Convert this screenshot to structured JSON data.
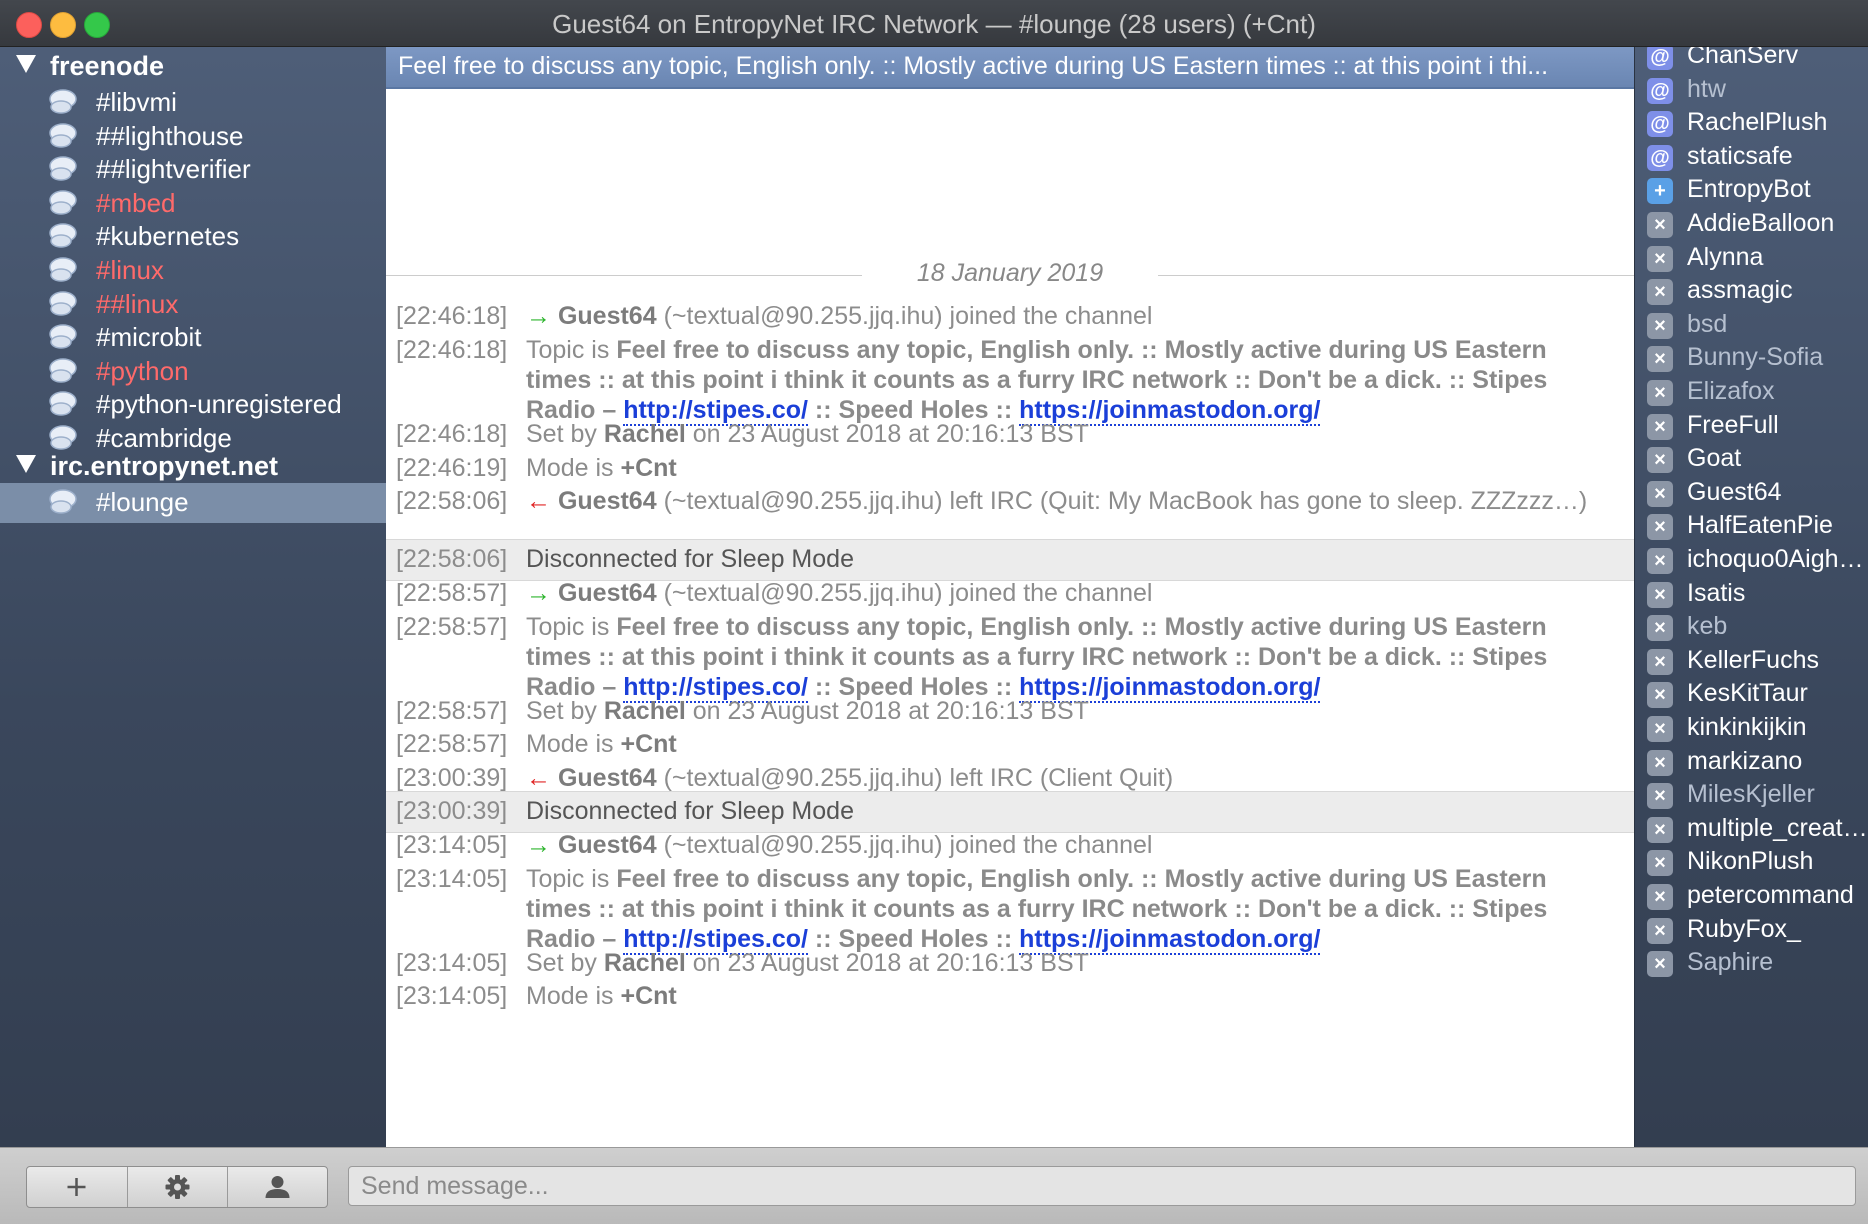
{
  "window": {
    "title": "Guest64 on EntropyNet IRC Network — #lounge (28 users) (+Cnt)"
  },
  "servers": [
    {
      "name": "freenode",
      "channels": [
        {
          "name": "#libvmi",
          "active": true
        },
        {
          "name": "##lighthouse",
          "active": true
        },
        {
          "name": "##lightverifier",
          "active": true
        },
        {
          "name": "#mbed",
          "active": false
        },
        {
          "name": "#kubernetes",
          "active": true
        },
        {
          "name": "#linux",
          "active": false
        },
        {
          "name": "##linux",
          "active": false
        },
        {
          "name": "#microbit",
          "active": true
        },
        {
          "name": "#python",
          "active": false
        },
        {
          "name": "#python-unregistered",
          "active": true
        },
        {
          "name": "#cambridge",
          "active": true
        }
      ]
    },
    {
      "name": "irc.entropynet.net",
      "channels": [
        {
          "name": "#lounge",
          "active": true,
          "selected": true
        }
      ]
    }
  ],
  "topic_bar": "Feel free to discuss any topic, English only. :: Mostly active during US Eastern times :: at this point i thi...",
  "date_divider": "18 January 2019",
  "topic_text": "Feel free to discuss any topic, English only. :: Mostly active during US Eastern times :: at this point i think it counts as a furry IRC network :: Don't be a dick. :: Stipes Radio – ",
  "topic_link1": "http://stipes.co/",
  "topic_mid": " :: Speed Holes :: ",
  "topic_link2": "https://joinmastodon.org/",
  "messages": {
    "m1": {
      "ts": "[22:46:18]",
      "nick": "Guest64",
      "rest": " (~textual@90.255.jjq.ihu) joined the channel"
    },
    "m2": {
      "ts": "[22:46:18]",
      "label": "Topic is "
    },
    "m3": {
      "ts": "[22:46:18]",
      "pre": "Set by ",
      "nick": "Rachel",
      "rest": " on 23 August 2018 at 20:16:13 BST"
    },
    "m4": {
      "ts": "[22:46:19]",
      "pre": "Mode is ",
      "mode": "+Cnt"
    },
    "m5": {
      "ts": "[22:58:06]",
      "nick": "Guest64",
      "rest": " (~textual@90.255.jjq.ihu) left IRC (Quit: My MacBook has gone to sleep. ZZZzzz…)"
    },
    "d1": {
      "ts": "[22:58:06]",
      "text": "Disconnected for Sleep Mode"
    },
    "m6": {
      "ts": "[22:58:57]",
      "nick": "Guest64",
      "rest": " (~textual@90.255.jjq.ihu) joined the channel"
    },
    "m7": {
      "ts": "[22:58:57]",
      "label": "Topic is "
    },
    "m8": {
      "ts": "[22:58:57]",
      "pre": "Set by ",
      "nick": "Rachel",
      "rest": " on 23 August 2018 at 20:16:13 BST"
    },
    "m9": {
      "ts": "[22:58:57]",
      "pre": "Mode is ",
      "mode": "+Cnt"
    },
    "m10": {
      "ts": "[23:00:39]",
      "nick": "Guest64",
      "rest": " (~textual@90.255.jjq.ihu) left IRC (Client Quit)"
    },
    "d2": {
      "ts": "[23:00:39]",
      "text": "Disconnected for Sleep Mode"
    },
    "m11": {
      "ts": "[23:14:05]",
      "nick": "Guest64",
      "rest": " (~textual@90.255.jjq.ihu) joined the channel"
    },
    "m12": {
      "ts": "[23:14:05]",
      "label": "Topic is "
    },
    "m13": {
      "ts": "[23:14:05]",
      "pre": "Set by ",
      "nick": "Rachel",
      "rest": " on 23 August 2018 at 20:16:13 BST"
    },
    "m14": {
      "ts": "[23:14:05]",
      "pre": "Mode is ",
      "mode": "+Cnt"
    }
  },
  "users": [
    {
      "name": "ChanServ",
      "mode": "op",
      "away": false
    },
    {
      "name": "htw",
      "mode": "op",
      "away": true
    },
    {
      "name": "RachelPlush",
      "mode": "op",
      "away": false
    },
    {
      "name": "staticsafe",
      "mode": "op",
      "away": false
    },
    {
      "name": "EntropyBot",
      "mode": "voice",
      "away": false
    },
    {
      "name": "AddieBalloon",
      "mode": "none",
      "away": false
    },
    {
      "name": "Alynna",
      "mode": "none",
      "away": false
    },
    {
      "name": "assmagic",
      "mode": "none",
      "away": false
    },
    {
      "name": "bsd",
      "mode": "none",
      "away": true
    },
    {
      "name": "Bunny-Sofia",
      "mode": "none",
      "away": true
    },
    {
      "name": "Elizafox",
      "mode": "none",
      "away": true
    },
    {
      "name": "FreeFull",
      "mode": "none",
      "away": false
    },
    {
      "name": "Goat",
      "mode": "none",
      "away": false
    },
    {
      "name": "Guest64",
      "mode": "none",
      "away": false
    },
    {
      "name": "HalfEatenPie",
      "mode": "none",
      "away": false
    },
    {
      "name": "ichoquo0Aigh…",
      "mode": "none",
      "away": false
    },
    {
      "name": "Isatis",
      "mode": "none",
      "away": false
    },
    {
      "name": "keb",
      "mode": "none",
      "away": true
    },
    {
      "name": "KellerFuchs",
      "mode": "none",
      "away": false
    },
    {
      "name": "KesKitTaur",
      "mode": "none",
      "away": false
    },
    {
      "name": "kinkinkijkin",
      "mode": "none",
      "away": false
    },
    {
      "name": "markizano",
      "mode": "none",
      "away": false
    },
    {
      "name": "MilesKjeller",
      "mode": "none",
      "away": true
    },
    {
      "name": "multiple_creat…",
      "mode": "none",
      "away": false
    },
    {
      "name": "NikonPlush",
      "mode": "none",
      "away": false
    },
    {
      "name": "petercommand",
      "mode": "none",
      "away": false
    },
    {
      "name": "RubyFox_",
      "mode": "none",
      "away": false
    },
    {
      "name": "Saphire",
      "mode": "none",
      "away": true
    }
  ],
  "badges": {
    "op": "@",
    "voice": "+",
    "none": "×"
  },
  "input": {
    "placeholder": "Send message..."
  },
  "toolbar": {
    "add_icon": "plus-icon",
    "settings_icon": "gear-icon",
    "user_icon": "person-icon"
  },
  "colors": {
    "inactive_channel": "#ff6a6a",
    "link": "#1b3fd8",
    "join_arrow": "#2fb52f",
    "quit_arrow": "#e02626",
    "topic_bar": "#7d98c4"
  }
}
